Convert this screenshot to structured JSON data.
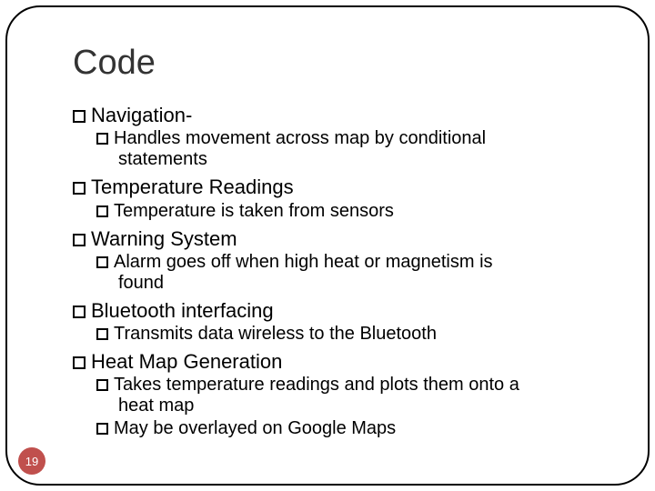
{
  "slide": {
    "title": "Code",
    "page_number": "19",
    "items": [
      {
        "label": "Navigation-",
        "sub": [
          {
            "text": "Handles movement across map by conditional",
            "cont": "statements"
          }
        ]
      },
      {
        "label": "Temperature Readings",
        "sub": [
          {
            "text": "Temperature is taken from sensors"
          }
        ]
      },
      {
        "label": "Warning System",
        "sub": [
          {
            "text": "Alarm goes off when high heat or magnetism is",
            "cont": "found"
          }
        ]
      },
      {
        "label": "Bluetooth interfacing",
        "sub": [
          {
            "text": "Transmits data wireless to the Bluetooth"
          }
        ]
      },
      {
        "label": "Heat Map Generation",
        "sub": [
          {
            "text": "Takes temperature readings and plots them onto a",
            "cont": "heat map"
          },
          {
            "text": "May be overlayed on Google Maps"
          }
        ]
      }
    ]
  }
}
